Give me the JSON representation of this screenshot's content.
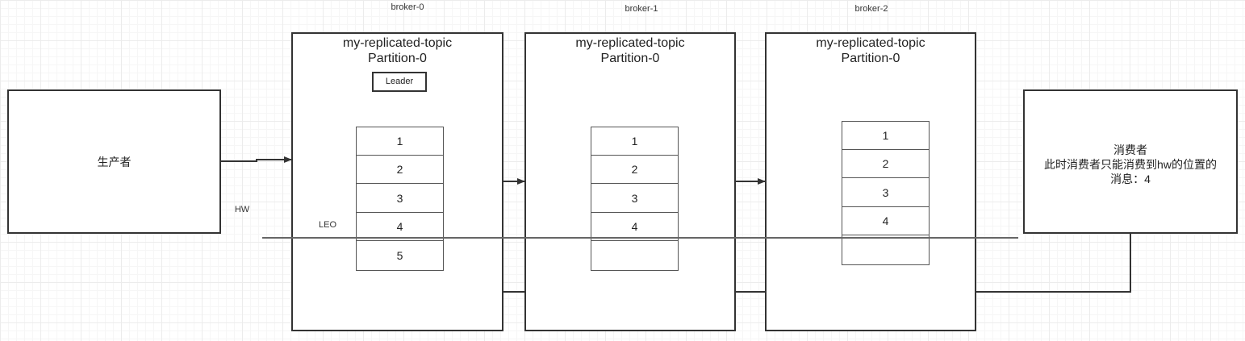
{
  "producer": {
    "label": "生产者"
  },
  "brokers": [
    {
      "name": "broker-0",
      "topic": "my-replicated-topic",
      "partition": "Partition-0",
      "role": "Leader",
      "cells": [
        "1",
        "2",
        "3",
        "4",
        "5"
      ]
    },
    {
      "name": "broker-1",
      "topic": "my-replicated-topic",
      "partition": "Partition-0",
      "cells": [
        "1",
        "2",
        "3",
        "4",
        ""
      ]
    },
    {
      "name": "broker-2",
      "topic": "my-replicated-topic",
      "partition": "Partition-0",
      "cells": [
        "1",
        "2",
        "3",
        "4",
        ""
      ]
    }
  ],
  "markers": {
    "hw": "HW",
    "leo": "LEO"
  },
  "consumer": {
    "title": "消费者",
    "line1": "此时消费者只能消费到hw的位置的",
    "line2": "消息：4"
  },
  "colors": {
    "stroke": "#333333",
    "hw_line": "#666666"
  }
}
